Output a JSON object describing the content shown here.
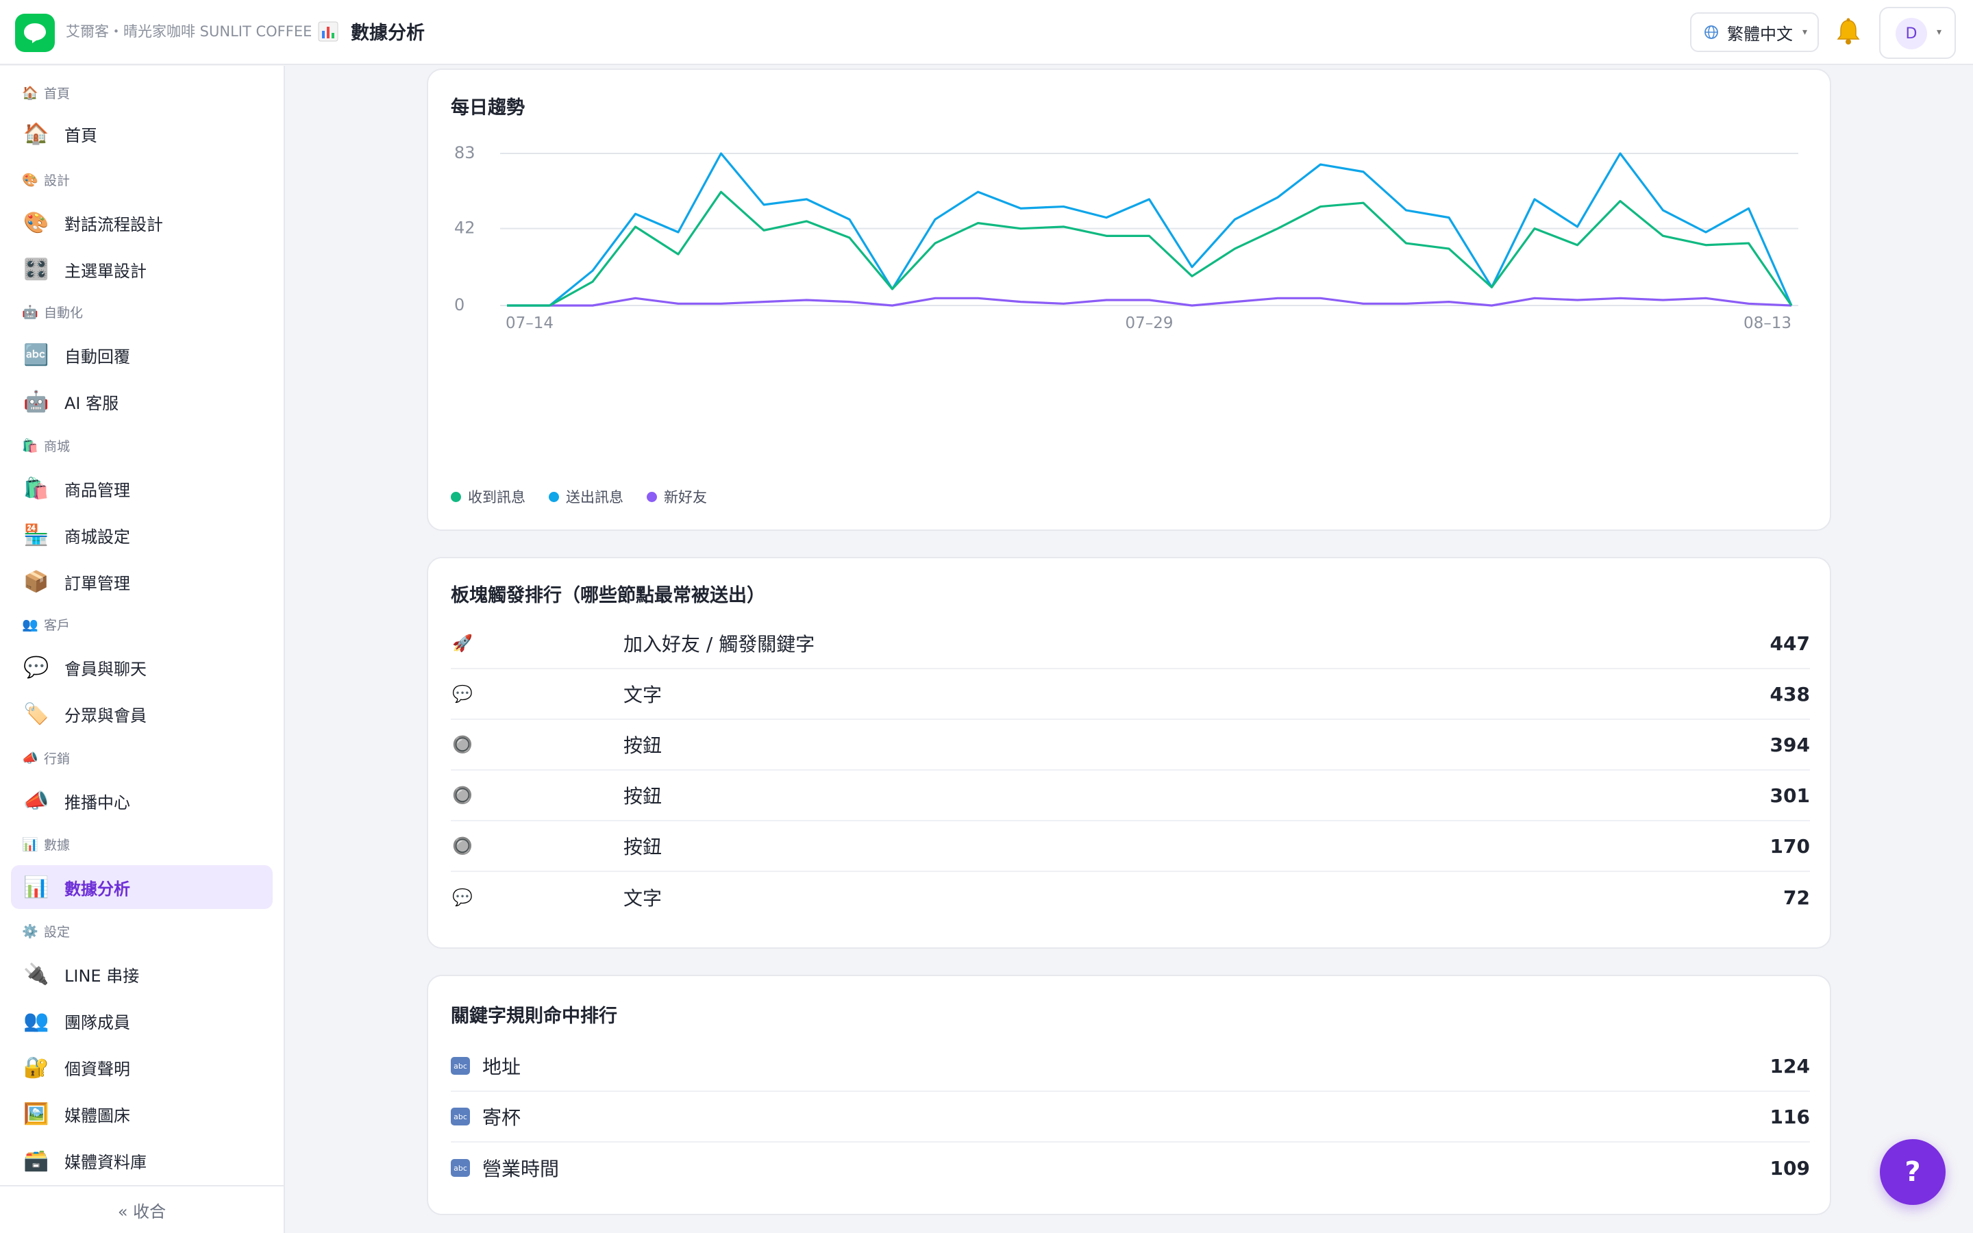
{
  "topbar": {
    "org_name": "艾爾客・晴光家咖啡 SUNLIT COFFEE",
    "page_icon": "bar-chart-icon",
    "page_title": "數據分析",
    "language": "繁體中文",
    "user_initial": "D"
  },
  "sidebar": {
    "sections": [
      {
        "label": "首頁",
        "icon": "🏠",
        "items": [
          {
            "label": "首頁",
            "icon": "🏠"
          }
        ]
      },
      {
        "label": "設計",
        "icon": "🎨",
        "items": [
          {
            "label": "對話流程設計",
            "icon": "🎨"
          },
          {
            "label": "主選單設計",
            "icon": "🎛️"
          }
        ]
      },
      {
        "label": "自動化",
        "icon": "🤖",
        "items": [
          {
            "label": "自動回覆",
            "icon": "🔤"
          },
          {
            "label": "AI 客服",
            "icon": "🤖"
          }
        ]
      },
      {
        "label": "商城",
        "icon": "🛍️",
        "items": [
          {
            "label": "商品管理",
            "icon": "🛍️"
          },
          {
            "label": "商城設定",
            "icon": "🏪"
          },
          {
            "label": "訂單管理",
            "icon": "📦"
          }
        ]
      },
      {
        "label": "客戶",
        "icon": "👥",
        "items": [
          {
            "label": "會員與聊天",
            "icon": "💬"
          },
          {
            "label": "分眾與會員",
            "icon": "🏷️"
          }
        ]
      },
      {
        "label": "行銷",
        "icon": "📣",
        "items": [
          {
            "label": "推播中心",
            "icon": "📣"
          }
        ]
      },
      {
        "label": "數據",
        "icon": "📊",
        "items": [
          {
            "label": "數據分析",
            "icon": "📊"
          }
        ]
      },
      {
        "label": "設定",
        "icon": "⚙️",
        "items": [
          {
            "label": "LINE 串接",
            "icon": "🔌"
          },
          {
            "label": "團隊成員",
            "icon": "👥"
          },
          {
            "label": "個資聲明",
            "icon": "🔐"
          },
          {
            "label": "媒體圖床",
            "icon": "🖼️"
          },
          {
            "label": "媒體資料庫",
            "icon": "🗃️"
          }
        ]
      }
    ],
    "active_item": "數據分析",
    "collapse_label": "« 收合"
  },
  "trend_card": {
    "title": "每日趨勢"
  },
  "chart_data": {
    "type": "line",
    "title": "每日趨勢",
    "xlabel": "",
    "ylabel": "",
    "ylim": [
      0,
      83
    ],
    "y_ticks": [
      0,
      42,
      83
    ],
    "x_ticks": [
      "07–14",
      "07–29",
      "08–13"
    ],
    "x": [
      "07-14",
      "07-15",
      "07-16",
      "07-17",
      "07-18",
      "07-19",
      "07-20",
      "07-21",
      "07-22",
      "07-23",
      "07-24",
      "07-25",
      "07-26",
      "07-27",
      "07-28",
      "07-29",
      "07-30",
      "07-31",
      "08-01",
      "08-02",
      "08-03",
      "08-04",
      "08-05",
      "08-06",
      "08-07",
      "08-08",
      "08-09",
      "08-10",
      "08-11",
      "08-12",
      "08-13"
    ],
    "series": [
      {
        "name": "收到訊息",
        "color": "#10b981",
        "values": [
          0,
          0,
          13,
          43,
          28,
          62,
          41,
          46,
          37,
          9,
          34,
          45,
          42,
          43,
          38,
          38,
          16,
          31,
          42,
          54,
          56,
          34,
          31,
          10,
          42,
          33,
          57,
          38,
          33,
          34,
          0
        ]
      },
      {
        "name": "送出訊息",
        "color": "#0ea5e9",
        "values": [
          0,
          0,
          19,
          50,
          40,
          83,
          55,
          58,
          47,
          9,
          47,
          62,
          53,
          54,
          48,
          58,
          21,
          47,
          59,
          77,
          73,
          52,
          48,
          10,
          58,
          43,
          83,
          52,
          40,
          53,
          0
        ]
      },
      {
        "name": "新好友",
        "color": "#8b5cf6",
        "values": [
          0,
          0,
          0,
          4,
          1,
          1,
          2,
          3,
          2,
          0,
          4,
          4,
          2,
          1,
          3,
          3,
          0,
          2,
          4,
          4,
          1,
          1,
          2,
          0,
          4,
          3,
          4,
          3,
          4,
          1,
          0
        ]
      }
    ],
    "legend_position": "bottom-left",
    "grid": true
  },
  "block_rank": {
    "title": "板塊觸發排行（哪些節點最常被送出）",
    "rows": [
      {
        "icon": "🚀",
        "label": "加入好友 / 觸發關鍵字",
        "value": "447"
      },
      {
        "icon": "💬",
        "label": "文字",
        "value": "438"
      },
      {
        "icon": "🔘",
        "label": "按鈕",
        "value": "394"
      },
      {
        "icon": "🔘",
        "label": "按鈕",
        "value": "301"
      },
      {
        "icon": "🔘",
        "label": "按鈕",
        "value": "170"
      },
      {
        "icon": "💬",
        "label": "文字",
        "value": "72"
      }
    ]
  },
  "keyword_rank": {
    "title": "關鍵字規則命中排行",
    "rows": [
      {
        "icon": "abc",
        "label": "地址",
        "value": "124"
      },
      {
        "icon": "abc",
        "label": "寄杯",
        "value": "116"
      },
      {
        "icon": "abc",
        "label": "營業時間",
        "value": "109"
      }
    ]
  },
  "help_button": {
    "label": "?"
  }
}
